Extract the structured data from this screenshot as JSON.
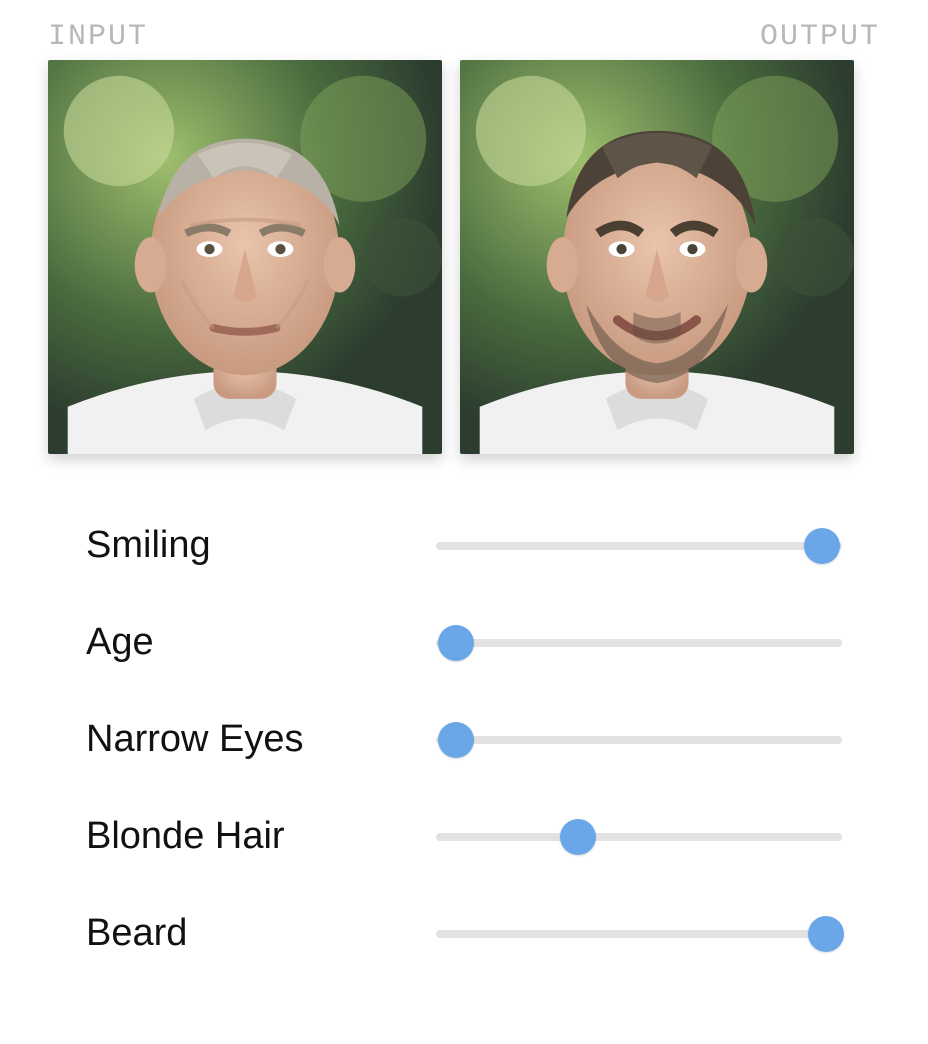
{
  "header": {
    "input_label": "INPUT",
    "output_label": "OUTPUT"
  },
  "images": {
    "input_alt": "input-face",
    "output_alt": "output-face"
  },
  "sliders": [
    {
      "key": "smiling",
      "label": "Smiling",
      "value": 95
    },
    {
      "key": "age",
      "label": "Age",
      "value": 5
    },
    {
      "key": "narrow_eyes",
      "label": "Narrow Eyes",
      "value": 5
    },
    {
      "key": "blonde_hair",
      "label": "Blonde Hair",
      "value": 35
    },
    {
      "key": "beard",
      "label": "Beard",
      "value": 96
    }
  ],
  "style": {
    "thumb_color": "#6aa7e8",
    "track_color": "#e2e2e2"
  }
}
